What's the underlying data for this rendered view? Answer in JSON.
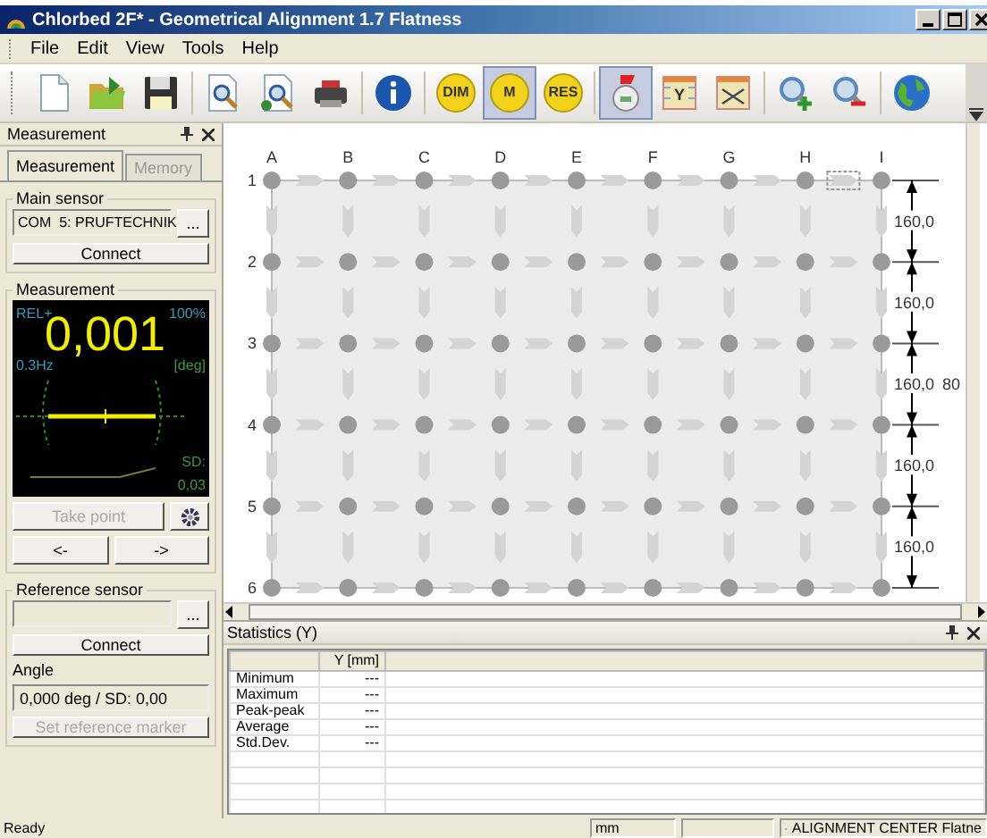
{
  "window": {
    "title": "Chlorbed 2F* - Geometrical Alignment 1.7 Flatness"
  },
  "menu": [
    "File",
    "Edit",
    "View",
    "Tools",
    "Help"
  ],
  "toolbar": {
    "groups": [
      [
        {
          "kind": "new",
          "selected": false
        },
        {
          "kind": "open",
          "selected": false
        },
        {
          "kind": "save",
          "selected": false
        }
      ],
      [
        {
          "kind": "preview",
          "selected": false
        },
        {
          "kind": "find",
          "selected": false
        },
        {
          "kind": "print",
          "selected": false
        }
      ],
      [
        {
          "kind": "info",
          "selected": false
        }
      ],
      [
        {
          "kind": "badge",
          "label": "DIM",
          "selected": false
        },
        {
          "kind": "badge",
          "label": "M",
          "selected": true
        },
        {
          "kind": "badge",
          "label": "RES",
          "selected": false
        }
      ],
      [
        {
          "kind": "counter",
          "selected": true
        },
        {
          "kind": "chart",
          "label": "Y",
          "selected": false
        },
        {
          "kind": "chart-cross",
          "selected": false
        }
      ],
      [
        {
          "kind": "zoom-in",
          "selected": false
        },
        {
          "kind": "zoom-out",
          "selected": false
        }
      ],
      [
        {
          "kind": "globe",
          "selected": false
        }
      ]
    ]
  },
  "measurement_panel": {
    "title": "Measurement",
    "tabs": [
      {
        "label": "Measurement",
        "selected": true
      },
      {
        "label": "Memory",
        "selected": false
      }
    ],
    "main_sensor": {
      "legend": "Main sensor",
      "port": "COM  5: PRUFTECHNIK",
      "browse": "...",
      "connect": "Connect"
    },
    "measurement": {
      "legend": "Measurement",
      "mode": "REL+",
      "value": "0,001",
      "percent": "100%",
      "frequency": "0.3Hz",
      "unit": "[deg]",
      "sd_label": "SD:",
      "sd_value": "0,03",
      "take_point": {
        "label": "Take point",
        "disabled": true
      },
      "prev": "<-",
      "next": "->"
    },
    "reference_sensor": {
      "legend": "Reference sensor",
      "browse": "...",
      "connect": "Connect",
      "angle_label": "Angle",
      "angle": "0,000 deg / SD: 0,00",
      "set_marker": {
        "label": "Set reference marker",
        "disabled": true
      }
    }
  },
  "grid": {
    "columns": [
      "A",
      "B",
      "C",
      "D",
      "E",
      "F",
      "G",
      "H",
      "I"
    ],
    "rows": [
      "1",
      "2",
      "3",
      "4",
      "5",
      "6"
    ],
    "segment_labels": [
      "160,0",
      "160,0",
      "160,0",
      "160,0",
      "160,0"
    ],
    "total_label": "80"
  },
  "statistics": {
    "title": "Statistics (Y)",
    "columns": [
      "Y [mm]"
    ],
    "rows": [
      {
        "label": "Minimum",
        "value": "---"
      },
      {
        "label": "Maximum",
        "value": "---"
      },
      {
        "label": "Peak-peak",
        "value": "---"
      },
      {
        "label": "Average",
        "value": "---"
      },
      {
        "label": "Std.Dev.",
        "value": "---"
      }
    ]
  },
  "status_bar": {
    "message": "Ready",
    "unit": "mm",
    "device": "ALIGNMENT CENTER Flatne"
  }
}
